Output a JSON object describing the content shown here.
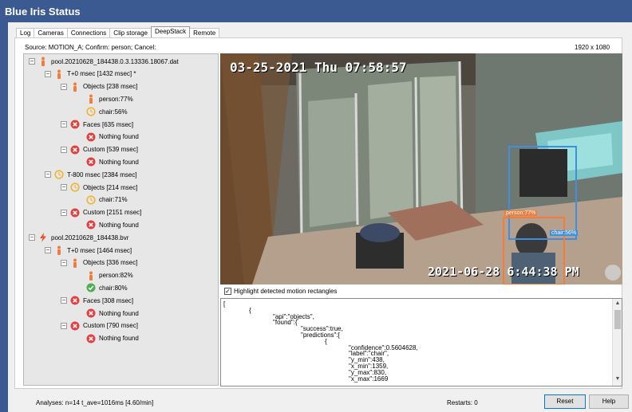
{
  "window": {
    "title": "Blue Iris Status"
  },
  "tabs": [
    "Log",
    "Cameras",
    "Connections",
    "Clip storage",
    "DeepStack",
    "Remote"
  ],
  "active_tab": "DeepStack",
  "header": {
    "source": "Source: MOTION_A; Confirm: person; Cancel:",
    "resolution": "1920 x 1080"
  },
  "tree": [
    {
      "label": "pool.20210628_184438.0.3.13336.18067.dat",
      "icon": "person-icon",
      "depth": 0,
      "expander": "−"
    },
    {
      "label": "T+0 msec [1432 msec] *",
      "icon": "person-icon",
      "depth": 1,
      "expander": "−"
    },
    {
      "label": "Objects [238 msec]",
      "icon": "person-icon",
      "depth": 2,
      "expander": "−"
    },
    {
      "label": "person:77%",
      "icon": "person-icon",
      "depth": 3,
      "expander": ""
    },
    {
      "label": "chair:56%",
      "icon": "clock-icon",
      "depth": 3,
      "expander": ""
    },
    {
      "label": "Faces [635 msec]",
      "icon": "error-icon",
      "depth": 2,
      "expander": "−"
    },
    {
      "label": "Nothing found",
      "icon": "error-icon",
      "depth": 3,
      "expander": ""
    },
    {
      "label": "Custom [539 msec]",
      "icon": "error-icon",
      "depth": 2,
      "expander": "−"
    },
    {
      "label": "Nothing found",
      "icon": "error-icon",
      "depth": 3,
      "expander": ""
    },
    {
      "label": "T-800 msec [2384 msec]",
      "icon": "clock-icon",
      "depth": 1,
      "expander": "−"
    },
    {
      "label": "Objects [214 msec]",
      "icon": "clock-icon",
      "depth": 2,
      "expander": "−"
    },
    {
      "label": "chair:71%",
      "icon": "clock-icon",
      "depth": 3,
      "expander": ""
    },
    {
      "label": "Custom [2151 msec]",
      "icon": "error-icon",
      "depth": 2,
      "expander": "−"
    },
    {
      "label": "Nothing found",
      "icon": "error-icon",
      "depth": 3,
      "expander": ""
    },
    {
      "label": "pool.20210628_184438.bvr",
      "icon": "bolt-icon",
      "depth": 0,
      "expander": "−"
    },
    {
      "label": "T+0 msec [1464 msec]",
      "icon": "person-icon",
      "depth": 1,
      "expander": "−"
    },
    {
      "label": "Objects [336 msec]",
      "icon": "person-icon",
      "depth": 2,
      "expander": "−"
    },
    {
      "label": "person:82%",
      "icon": "person-icon",
      "depth": 3,
      "expander": ""
    },
    {
      "label": "chair:80%",
      "icon": "check-icon",
      "depth": 3,
      "expander": ""
    },
    {
      "label": "Faces [308 msec]",
      "icon": "error-icon",
      "depth": 2,
      "expander": "−"
    },
    {
      "label": "Nothing found",
      "icon": "error-icon",
      "depth": 3,
      "expander": ""
    },
    {
      "label": "Custom [790 msec]",
      "icon": "error-icon",
      "depth": 2,
      "expander": "−"
    },
    {
      "label": "Nothing found",
      "icon": "error-icon",
      "depth": 3,
      "expander": ""
    }
  ],
  "video": {
    "timestamp_top": "03-25-2021 Thu 07:58:57",
    "timestamp_bottom": "2021-06-28 6:44:38 PM",
    "detections": [
      {
        "label": "person:77%",
        "color": "#f07d3c"
      },
      {
        "label": "chair:56%",
        "color": "#3d8fe0"
      }
    ]
  },
  "highlight": {
    "checked": "✓",
    "label": "Highlight detected motion rectangles"
  },
  "json_text": [
    "[",
    "{",
    "\"api\":\"objects\",",
    "\"found\":{",
    "\"success\":true,",
    "\"predictions\":[",
    "{",
    "\"confidence\":0.5604628,",
    "\"label\":\"chair\",",
    "\"y_min\":438,",
    "\"x_min\":1359,",
    "\"y_max\":830,",
    "\"x_max\":1669"
  ],
  "status": {
    "analyses": "Analyses:  n=14 t_ave=1016ms [4.60/min]",
    "restarts": "Restarts:  0"
  },
  "buttons": {
    "reset": "Reset",
    "help": "Help"
  },
  "colors": {
    "title_bar": "#3c5a92",
    "person": "#f07d3c",
    "error": "#e04040",
    "clock": "#f0b432",
    "check": "#4caf50",
    "bolt": "#e8542a"
  }
}
